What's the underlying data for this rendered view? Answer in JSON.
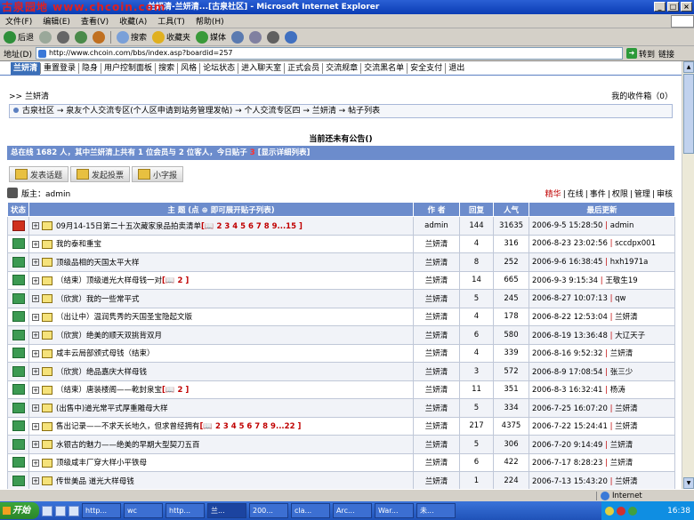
{
  "window": {
    "title": "兰妍清-兰妍清...[古泉社区] - Microsoft Internet Explorer",
    "watermark": "古泉园地 www.chcoin.com"
  },
  "menu": [
    "文件(F)",
    "编辑(E)",
    "查看(V)",
    "收藏(A)",
    "工具(T)",
    "帮助(H)"
  ],
  "toolbar": {
    "back": "后退",
    "search": "搜索",
    "favorites": "收藏夹",
    "media": "媒体"
  },
  "address": {
    "label": "地址(D)",
    "url": "http://www.chcoin.com/bbs/index.asp?boardid=257",
    "go": "转到",
    "links": "链接"
  },
  "nav": {
    "brand": "兰妍清",
    "items": [
      "重置登录",
      "隐身",
      "用户控制面板",
      "搜索",
      "风格",
      "论坛状态",
      "进入聊天室",
      "正式会员",
      "交流规章",
      "交流黑名单",
      "安全支付",
      "退出"
    ]
  },
  "crumbs": {
    "user": ">> 兰妍清",
    "inbox": "我的收件箱（0）",
    "path": "古泉社区 → 泉友个人交流专区(个人区申请到站务管理发帖) → 个人交流专区四 → 兰妍清 → 帖子列表"
  },
  "notice": "当前还未有公告()",
  "online": {
    "text_prefix": "总在线 1682 人，其中兰妍清上共有 1 位会员与 2 位客人，今日贴子",
    "today": "3",
    "text_suffix": "[显示详细列表]"
  },
  "actions": [
    "发表话题",
    "发起投票",
    "小字报"
  ],
  "moderator": "版主：admin",
  "tabs": [
    "精华",
    "在线",
    "事件",
    "权限",
    "管理",
    "审核"
  ],
  "table": {
    "headers": [
      "状态",
      "主 题 (点 ⊕ 即可展开贴子列表)",
      "作 者",
      "回复",
      "人气",
      "最后更新"
    ],
    "rows": [
      {
        "hot": true,
        "title": "09月14-15日第二十五次藏家泉品拍卖清单",
        "pages": "[📖 2 3 4 5 6 7 8 9...15 ]",
        "author": "admin",
        "replies": "144",
        "views": "31635",
        "last_time": "2006-9-5 15:28:50",
        "last_user": "admin"
      },
      {
        "hot": false,
        "title": "我的泰和重宝",
        "pages": "",
        "author": "兰妍清",
        "replies": "4",
        "views": "316",
        "last_time": "2006-8-23 23:02:56",
        "last_user": "sccdpx001"
      },
      {
        "hot": false,
        "title": "顶级品相的天国太平大样",
        "pages": "",
        "author": "兰妍清",
        "replies": "8",
        "views": "252",
        "last_time": "2006-9-6 16:38:45",
        "last_user": "hxh1971a"
      },
      {
        "hot": false,
        "title": "（结束）顶级道光大样母钱一对",
        "pages": "[📖 2 ]",
        "author": "兰妍清",
        "replies": "14",
        "views": "665",
        "last_time": "2006-9-3 9:15:34",
        "last_user": "王敬生19"
      },
      {
        "hot": false,
        "title": "（欣赏）我的一些常平式",
        "pages": "",
        "author": "兰妍清",
        "replies": "5",
        "views": "245",
        "last_time": "2006-8-27 10:07:13",
        "last_user": "qw"
      },
      {
        "hot": false,
        "title": "（出让中）温润隽秀的天国圣宝隐起文版",
        "pages": "",
        "author": "兰妍清",
        "replies": "4",
        "views": "178",
        "last_time": "2006-8-22 12:53:04",
        "last_user": "兰妍清"
      },
      {
        "hot": false,
        "title": "（欣赏）绝美的顺天双挑背双月",
        "pages": "",
        "author": "兰妍清",
        "replies": "6",
        "views": "580",
        "last_time": "2006-8-19 13:36:48",
        "last_user": "大辽天子"
      },
      {
        "hot": false,
        "title": "咸丰云局部颁式母钱（结束）",
        "pages": "",
        "author": "兰妍清",
        "replies": "4",
        "views": "339",
        "last_time": "2006-8-16 9:52:32",
        "last_user": "兰妍清"
      },
      {
        "hot": false,
        "title": "（欣赏）绝品嘉庆大样母钱",
        "pages": "",
        "author": "兰妍清",
        "replies": "3",
        "views": "572",
        "last_time": "2006-8-9 17:08:54",
        "last_user": "张三少"
      },
      {
        "hot": false,
        "title": "（结束）唐装楼阁——乾封泉宝",
        "pages": "[📖 2 ]",
        "author": "兰妍清",
        "replies": "11",
        "views": "351",
        "last_time": "2006-8-3 16:32:41",
        "last_user": "杨涛"
      },
      {
        "hot": false,
        "title": "(出售中)道光常平式厚重雕母大样",
        "pages": "",
        "author": "兰妍清",
        "replies": "5",
        "views": "334",
        "last_time": "2006-7-25 16:07:20",
        "last_user": "兰妍清"
      },
      {
        "hot": false,
        "title": "售出记录——不求天长地久，但求曾经拥有",
        "pages": "[📖 2 3 4 5 6 7 8 9...22 ]",
        "author": "兰妍清",
        "replies": "217",
        "views": "4375",
        "last_time": "2006-7-22 15:24:41",
        "last_user": "兰妍清"
      },
      {
        "hot": false,
        "title": "水银古的魅力——绝美的早期大型契刀五百",
        "pages": "",
        "author": "兰妍清",
        "replies": "5",
        "views": "306",
        "last_time": "2006-7-20 9:14:49",
        "last_user": "兰妍清"
      },
      {
        "hot": false,
        "title": "顶级咸丰厂穿大样小平铁母",
        "pages": "",
        "author": "兰妍清",
        "replies": "6",
        "views": "422",
        "last_time": "2006-7-17 8:28:23",
        "last_user": "兰妍清"
      },
      {
        "hot": false,
        "title": "传世美品 道光大样母钱",
        "pages": "",
        "author": "兰妍清",
        "replies": "1",
        "views": "224",
        "last_time": "2006-7-13 15:43:20",
        "last_user": "兰妍清"
      }
    ]
  },
  "statusbar": {
    "zone": "Internet"
  },
  "taskbar": {
    "start": "开始",
    "tasks": [
      "http...",
      "wc",
      "http...",
      "兰...",
      "200...",
      "cla...",
      "Arc...",
      "War...",
      "未..."
    ],
    "clock": "16:38"
  },
  "colors": {
    "header_blue": "#6c8ccc",
    "accent_red": "#c00000"
  }
}
